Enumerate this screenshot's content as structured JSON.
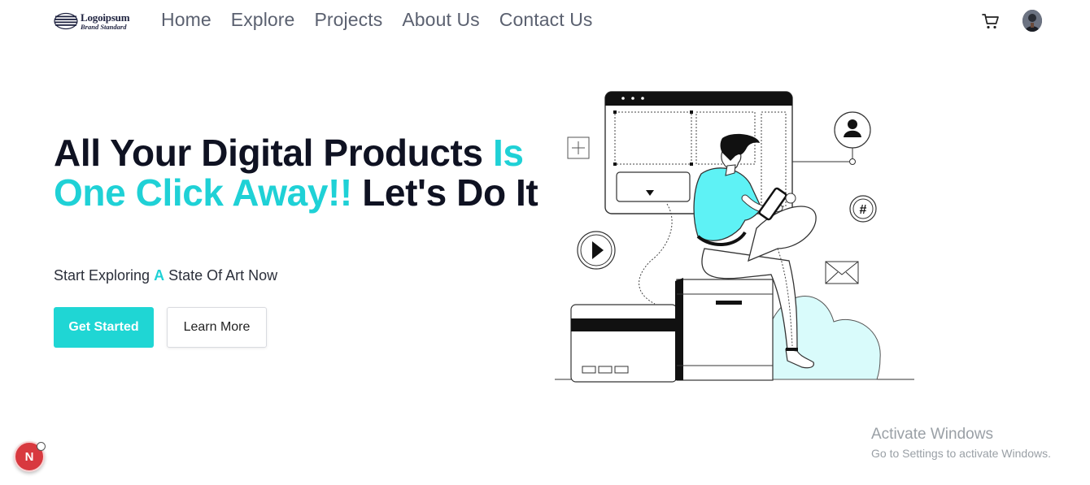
{
  "brand": {
    "name": "Logoipsum",
    "tagline": "Brand Standard"
  },
  "nav": {
    "links": [
      {
        "label": "Home"
      },
      {
        "label": "Explore"
      },
      {
        "label": "Projects"
      },
      {
        "label": "About Us"
      },
      {
        "label": "Contact Us"
      }
    ],
    "icons": [
      "cart-icon",
      "avatar"
    ]
  },
  "hero": {
    "title_part1": "All Your Digital Products ",
    "title_accent": "Is One Click Away!!",
    "title_part2": " Let's Do It",
    "subtitle_before": "Start Exploring ",
    "subtitle_accent": "A",
    "subtitle_after": " State Of Art Now",
    "primary_button": "Get Started",
    "secondary_button": "Learn More"
  },
  "colors": {
    "accent": "#1fd1d6",
    "title": "#0f1222",
    "nav": "#5b6170"
  },
  "watermark": {
    "title": "Activate Windows",
    "subtitle": "Go to Settings to activate Windows."
  },
  "badge": {
    "letter": "N"
  }
}
